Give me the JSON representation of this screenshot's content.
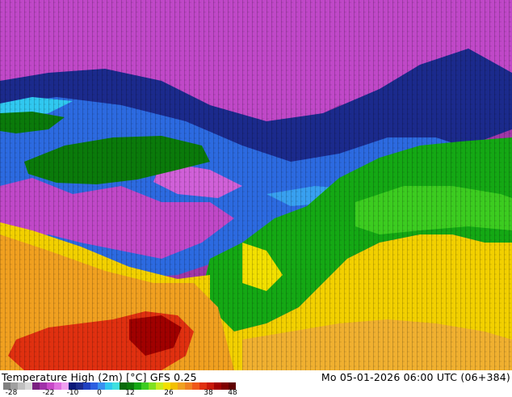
{
  "map": {
    "description_colors": {
      "deep_purple": "#6a1f6f",
      "magenta": "#c040c8",
      "pink": "#e070e0",
      "navy": "#1b2a8c",
      "blue": "#2c5fe0",
      "cyan": "#30c8f0",
      "green_dark": "#0a7a0a",
      "green": "#14a814",
      "green_light": "#3ccc20",
      "yellow": "#f2d000",
      "orange": "#f0a020",
      "red": "#e03010",
      "darkred": "#a00000"
    }
  },
  "footer": {
    "title_left": "Temperature High (2m) [°C] GFS 0.25",
    "title_right": "Mo 05-01-2026 06:00 UTC (06+384)"
  },
  "legend": {
    "ticks": [
      "-28",
      "-22",
      "-10",
      "0",
      "12",
      "26",
      "38",
      "48"
    ],
    "colors": [
      "#808080",
      "#a0a0a0",
      "#c0c0c0",
      "#d8d8d8",
      "#7a2080",
      "#a030a8",
      "#c848c8",
      "#e070e0",
      "#f0a0f0",
      "#0a1878",
      "#1b2a8c",
      "#2040c0",
      "#2c5fe0",
      "#3890f0",
      "#30c8f0",
      "#40e0e0",
      "#0a6a0a",
      "#0a7a0a",
      "#14a814",
      "#3ccc20",
      "#80e020",
      "#c8ec20",
      "#f2e000",
      "#f2c000",
      "#f0a020",
      "#f08020",
      "#f05818",
      "#e03010",
      "#c81808",
      "#a00000",
      "#800000",
      "#600000"
    ]
  }
}
